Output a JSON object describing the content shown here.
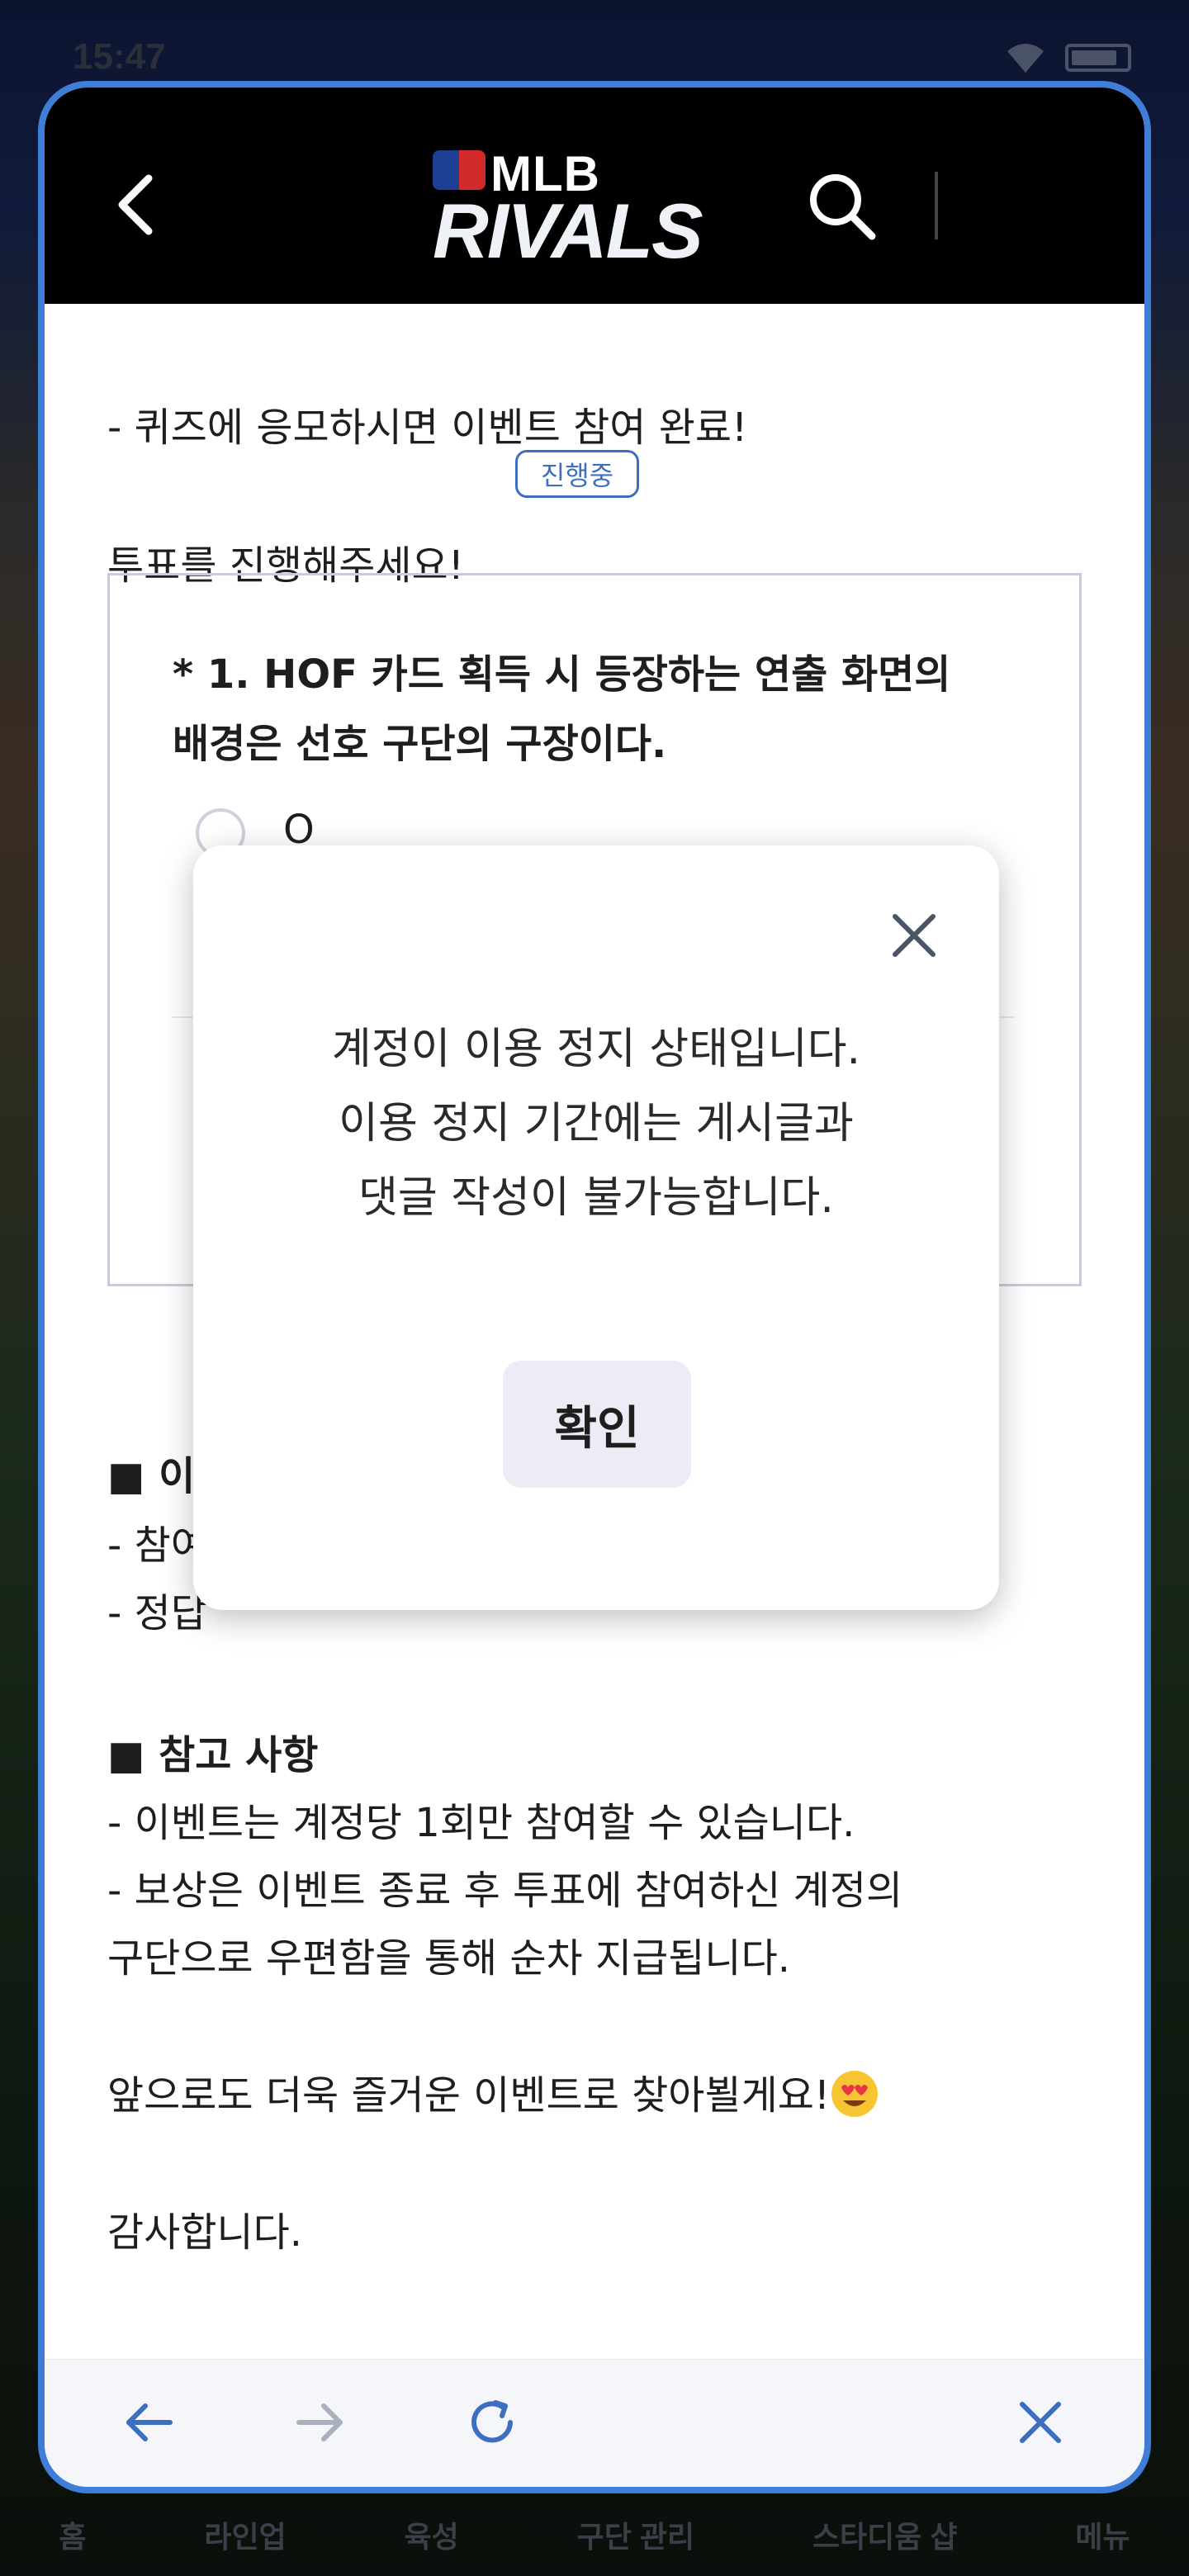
{
  "status_bar": {
    "time": "15:47"
  },
  "background_nav": [
    "홈",
    "라인업",
    "육성",
    "구단 관리",
    "스타디움 샵",
    "메뉴"
  ],
  "header": {
    "logo_top": "MLB",
    "logo_bottom": "RIVALS"
  },
  "content": {
    "line1": "- 퀴즈에 응모하시면 이벤트 참여 완료!",
    "vote_prompt": "투표를 진행해주세요!",
    "status_chip": "진행중",
    "question_line1": "* 1. HOF 카드 획득 시 등장하는 연출 화면의",
    "question_line2": "배경은 선호 구단의 구장이다.",
    "option_o": "O",
    "hidden_section_title": "■ 이",
    "hidden_line1": "- 참여",
    "hidden_line2": "- 정답",
    "notes_title": "■ 참고 사항",
    "notes_line1": "- 이벤트는 계정당 1회만 참여할 수 있습니다.",
    "notes_line2": "- 보상은 이벤트 종료 후 투표에 참여하신 계정의",
    "notes_line3": "구단으로 우편함을 통해 순차 지급됩니다.",
    "closing": "앞으로도 더욱 즐거운 이벤트로 찾아뵐게요!",
    "thanks": "감사합니다."
  },
  "modal": {
    "message_line1": "계정이 이용 정지 상태입니다.",
    "message_line2": "이용 정지 기간에는 게시글과",
    "message_line3": "댓글 작성이 불가능합니다.",
    "confirm_label": "확인"
  },
  "icons": {
    "back": "chevron-left-icon",
    "search": "search-icon",
    "close": "close-icon",
    "browser_back": "arrow-left-icon",
    "browser_forward": "arrow-right-icon",
    "refresh": "refresh-icon",
    "browser_close": "close-icon"
  },
  "colors": {
    "accent": "#3d6fc0",
    "frame": "#3f7ed8",
    "header_bg": "#000000"
  }
}
